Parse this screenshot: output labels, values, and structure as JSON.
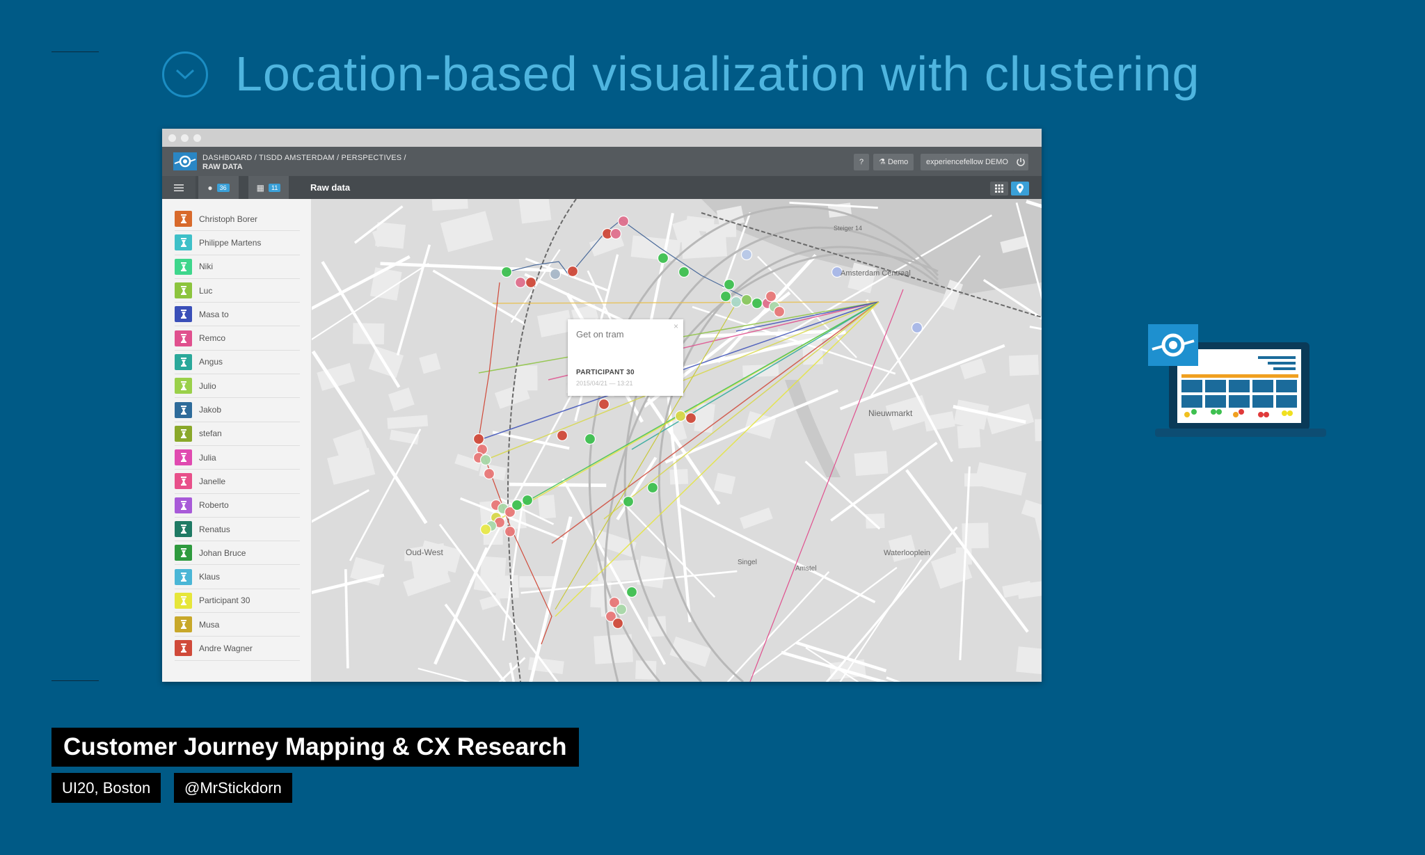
{
  "slide": {
    "title": "Location-based visualization with clustering",
    "talk_title": "Customer Journey Mapping & CX Research",
    "event": "UI20, Boston",
    "handle": "@MrStickdorn"
  },
  "app": {
    "breadcrumb_path": "DASHBOARD / TISDD AMSTERDAM / PERSPECTIVES /",
    "breadcrumb_page": "RAW DATA",
    "help_label": "?",
    "demo_label": "Demo",
    "account_label": "experiencefellow DEMO",
    "power_icon": "power-icon",
    "participants_badge": "36",
    "touchpoints_badge": "11",
    "toolbar_title": "Raw data",
    "colors": {
      "accent": "#3aa0d8",
      "appbar": "#555a5e",
      "toolbar": "#454a4e"
    }
  },
  "participants": [
    {
      "name": "Christoph Borer",
      "color": "#d86a2c"
    },
    {
      "name": "Philippe Martens",
      "color": "#3ec0c8"
    },
    {
      "name": "Niki",
      "color": "#3ed68c"
    },
    {
      "name": "Luc",
      "color": "#8cc43e"
    },
    {
      "name": "Masa to",
      "color": "#3a4fb8"
    },
    {
      "name": "Remco",
      "color": "#e0508e"
    },
    {
      "name": "Angus",
      "color": "#2aa89a"
    },
    {
      "name": "Julio",
      "color": "#9ad04a"
    },
    {
      "name": "Jakob",
      "color": "#2e6b9a"
    },
    {
      "name": "stefan",
      "color": "#8aa82a"
    },
    {
      "name": "Julia",
      "color": "#e04ab0"
    },
    {
      "name": "Janelle",
      "color": "#e8508a"
    },
    {
      "name": "Roberto",
      "color": "#a85ad8"
    },
    {
      "name": "Renatus",
      "color": "#1f7a64"
    },
    {
      "name": "Johan Bruce",
      "color": "#2e9a3e"
    },
    {
      "name": "Klaus",
      "color": "#4ab6d6"
    },
    {
      "name": "Participant 30",
      "color": "#e6e63a"
    },
    {
      "name": "Musa",
      "color": "#c8a82a"
    },
    {
      "name": "Andre Wagner",
      "color": "#d04a3a"
    }
  ],
  "map": {
    "popup": {
      "title": "Get on tram",
      "participant": "PARTICIPANT 30",
      "date": "2015/04/21 — 13:21",
      "close": "×"
    },
    "labels": {
      "centraal": "Amsterdam Centraal",
      "nieuwmarkt": "Nieuwmarkt",
      "waterlooplein": "Waterlooplein",
      "oud_west": "Oud-West",
      "singel": "Singel",
      "amstel": "Amstel",
      "steiger": "Steiger 14"
    }
  }
}
